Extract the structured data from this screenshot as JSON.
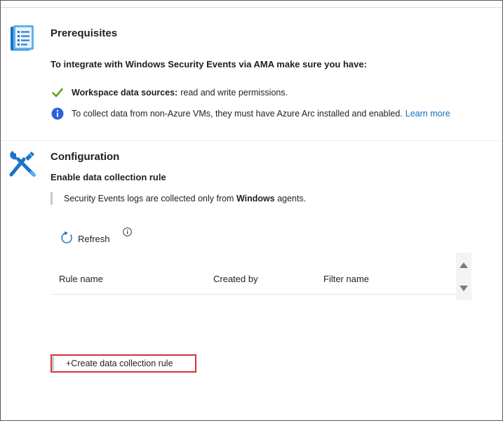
{
  "prerequisites": {
    "title": "Prerequisites",
    "intro": "To integrate with Windows Security Events via AMA make sure you have:",
    "items": [
      {
        "icon": "check-icon",
        "bold": "Workspace data sources:",
        "text": "read and write permissions."
      },
      {
        "icon": "info-icon",
        "text": "To collect data from non-Azure VMs, they must have Azure Arc installed and enabled.",
        "link": "Learn more"
      }
    ]
  },
  "configuration": {
    "title": "Configuration",
    "subtitle": "Enable data collection rule",
    "note": {
      "prefix": "Security Events logs are collected only from",
      "bold": "Windows",
      "suffix": "agents."
    },
    "refresh_label": "Refresh",
    "table": {
      "columns": [
        "Rule name",
        "Created by",
        "Filter name"
      ],
      "rows": []
    },
    "create_button_label": "+Create data collection rule"
  },
  "colors": {
    "accent_link": "#0f6cbd",
    "check_green": "#5ea51f",
    "info_blue": "#2e62d9",
    "highlight_red": "#d13438"
  }
}
